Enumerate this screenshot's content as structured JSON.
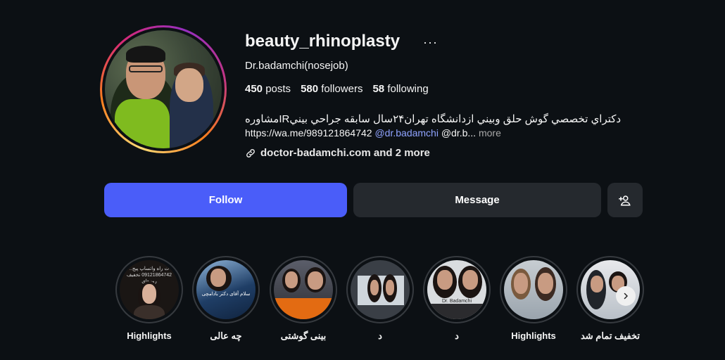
{
  "profile": {
    "username": "beauty_rhinoplasty",
    "more_icon": "more-horizontal-icon",
    "full_name": "Dr.badamchi(nosejob)",
    "stats": {
      "posts_count": "450",
      "posts_label": "posts",
      "followers_count": "580",
      "followers_label": "followers",
      "following_count": "58",
      "following_label": "following"
    },
    "bio_line1": "دكتراي تخصصي گوش حلق وبيني ازدانشگاه تهران۲۴سال سابقه جراحي بينيIRمشاوره",
    "bio_link_text": "https://wa.me/989121864742",
    "bio_mention": "@dr.badamchi",
    "bio_truncated": "@dr.b...",
    "bio_more": "more",
    "website": "doctor-badamchi.com and 2 more",
    "link_icon": "link-icon"
  },
  "actions": {
    "follow_label": "Follow",
    "message_label": "Message",
    "add_user_icon": "add-user-icon"
  },
  "highlights": [
    {
      "label": "Highlights",
      "image_text": "..ت راه واتساپ پیج 09121864742 تخفیف روزهای"
    },
    {
      "label": "چه عالی",
      "image_text": "سلام آقای دکتر بادامچی"
    },
    {
      "label": "بینی گوشتی",
      "image_text": ""
    },
    {
      "label": "د",
      "image_text": ""
    },
    {
      "label": "د",
      "image_text": "Dr. Badamchi"
    },
    {
      "label": "Highlights",
      "image_text": ""
    },
    {
      "label": "تخفیف تمام شد",
      "image_text": ""
    }
  ],
  "colors": {
    "background": "#0c1014",
    "follow_button": "#4a5df9",
    "secondary_button": "#25292e",
    "mention": "#8fa3ff"
  }
}
